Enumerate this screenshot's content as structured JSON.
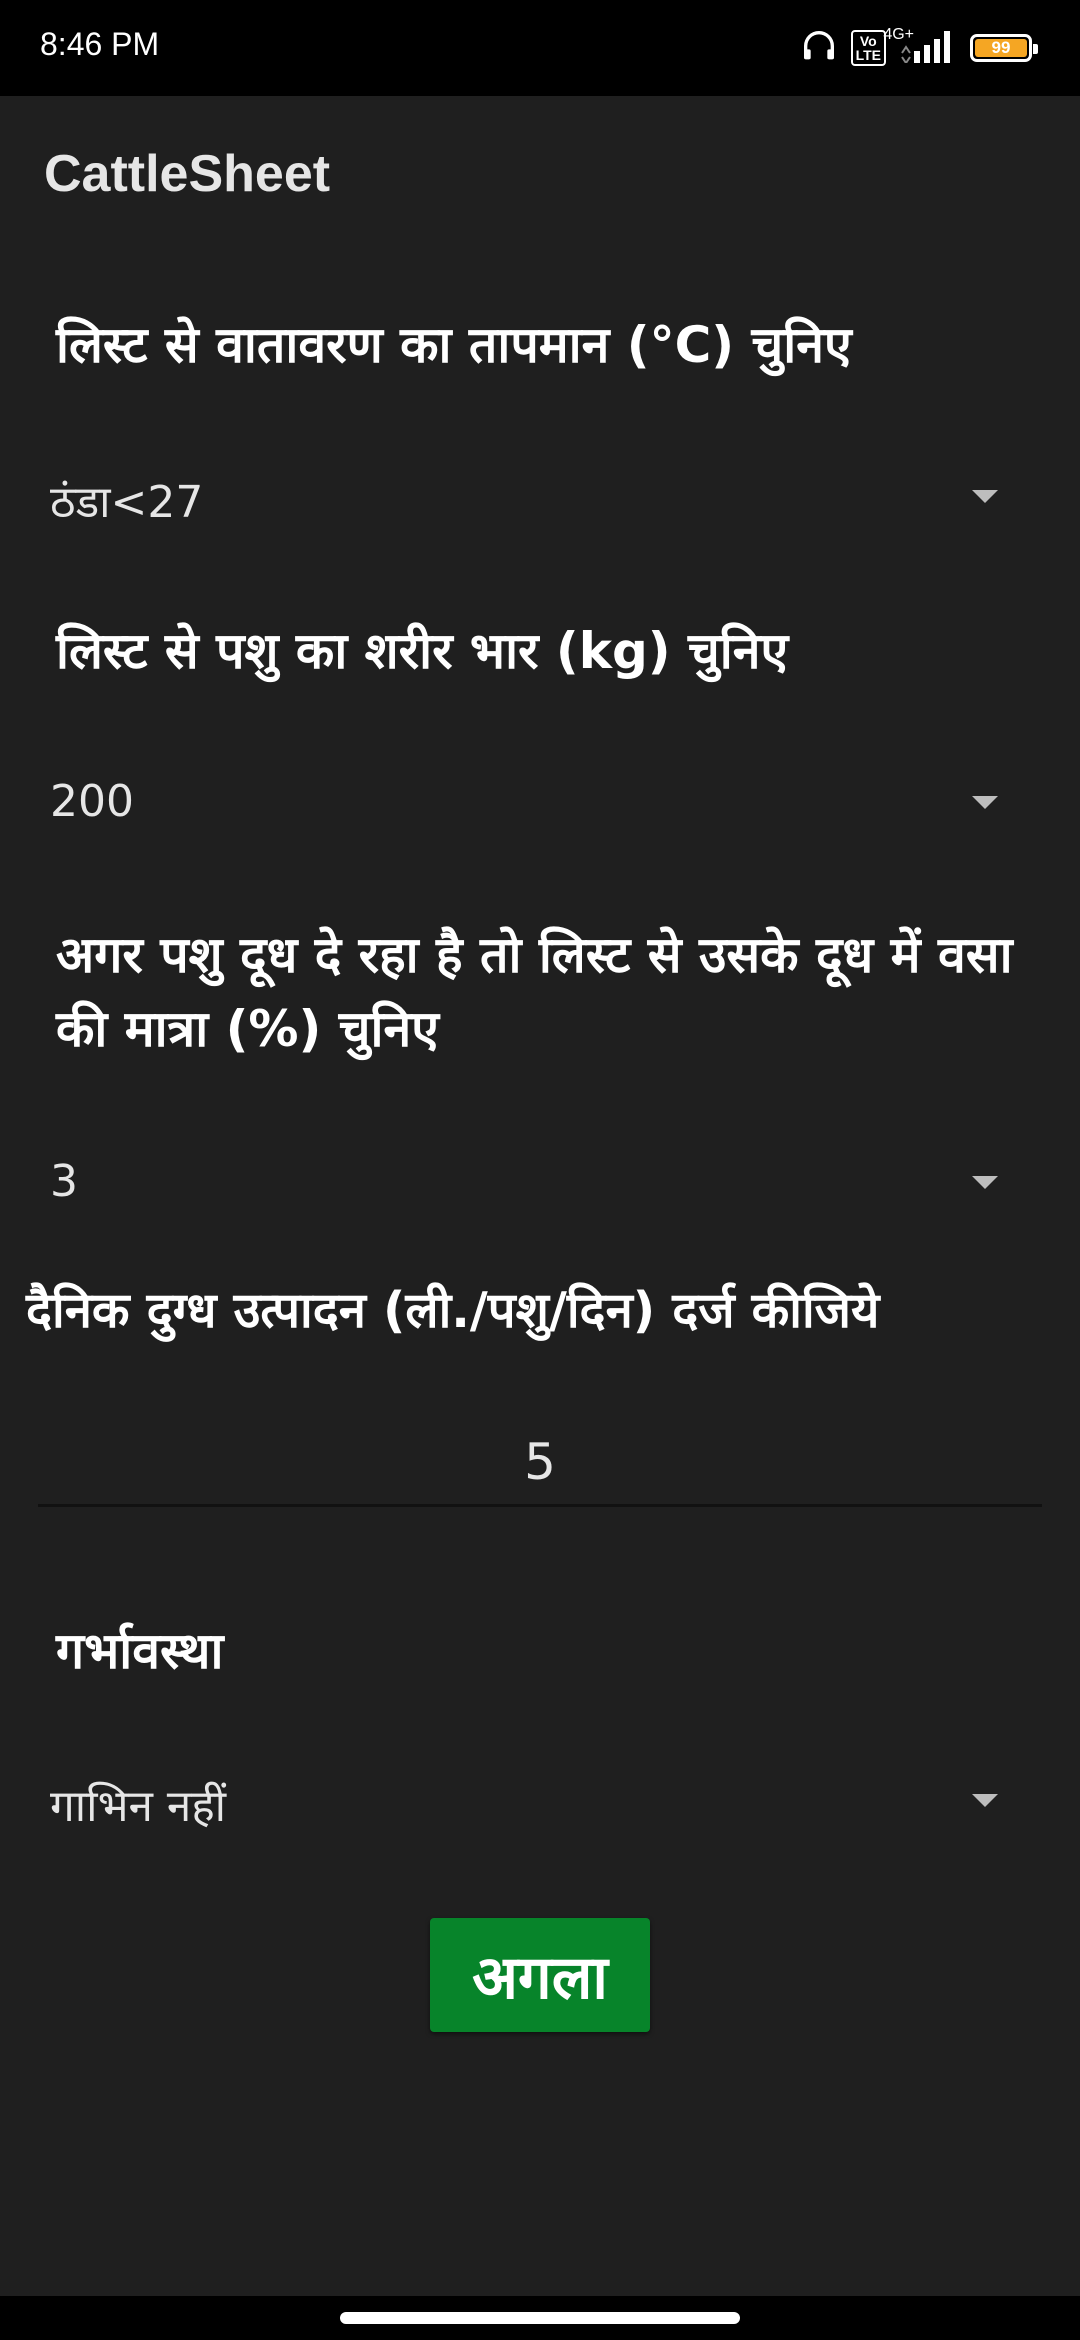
{
  "status_bar": {
    "time": "8:46 PM",
    "volte_label": "Vo\nLTE",
    "network_type": "4G+",
    "battery_level": "99",
    "icons": [
      "headphones-icon",
      "volte-icon",
      "signal-icon",
      "battery-icon"
    ],
    "battery_color": "#f5a623"
  },
  "app_bar": {
    "title": "CattleSheet"
  },
  "form": {
    "temperature": {
      "label": "लिस्ट से वातावरण का तापमान (°C) चुनिए",
      "selected": "ठंडा<27"
    },
    "body_weight": {
      "label": "लिस्ट से पशु का शरीर भार (kg) चुनिए",
      "selected": "200"
    },
    "milk_fat": {
      "label": "अगर पशु दूध दे रहा है तो लिस्ट से उसके दूध में वसा की मात्रा (%) चुनिए",
      "selected": "3"
    },
    "milk_yield": {
      "label": "दैनिक दुग्ध उत्पादन (ली./पशु/दिन) दर्ज कीजिये",
      "value": "5"
    },
    "pregnancy": {
      "label": "गर्भावस्था",
      "selected": "गाभिन नहीं"
    },
    "next_button": "अगला"
  },
  "colors": {
    "background": "#1f1f1f",
    "button": "#07842a"
  }
}
